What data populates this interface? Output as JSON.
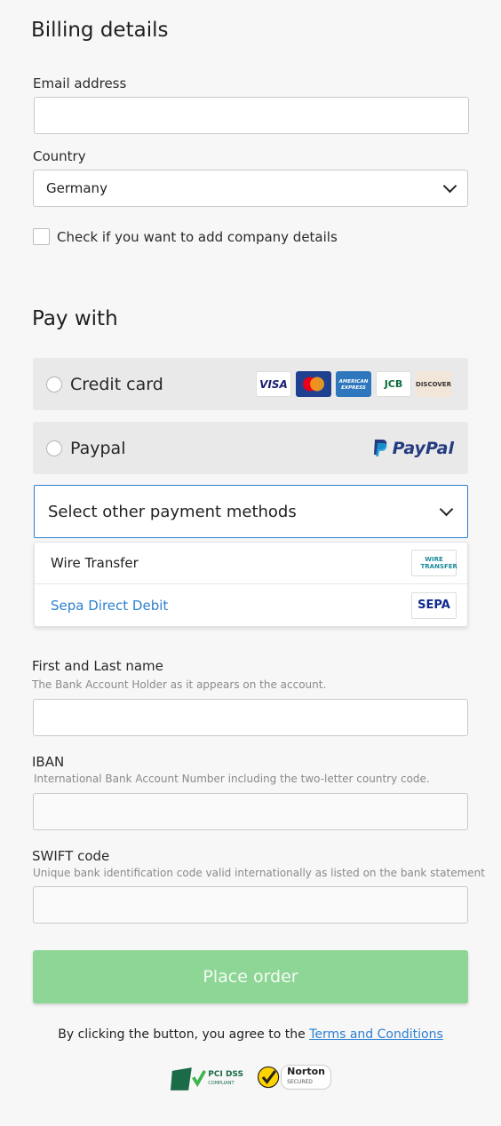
{
  "billing": {
    "title": "Billing details",
    "email_label": "Email address",
    "email_value": "",
    "country_label": "Country",
    "country_value": "Germany",
    "company_checkbox_label": "Check if you want to add company details"
  },
  "payment": {
    "title": "Pay with",
    "credit_card_label": "Credit card",
    "card_logos": [
      "VISA",
      "MasterCard",
      "AMERICAN EXPRESS",
      "JCB",
      "DISCOVER"
    ],
    "paypal_label": "Paypal",
    "paypal_logo": "PayPal",
    "other_methods_label": "Select other payment methods",
    "options": [
      {
        "label": "Wire Transfer",
        "logo": "WIRE TRANSFER",
        "color": "#222222"
      },
      {
        "label": "Sepa Direct Debit",
        "logo": "SEPA",
        "color": "#2d7fd0"
      }
    ]
  },
  "sepa_form": {
    "name_label": "First and Last name",
    "name_hint": "The Bank Account Holder as it appears on the account.",
    "iban_label": "IBAN",
    "iban_hint": "International Bank Account Number including the two-letter country code.",
    "swift_label": "SWIFT code",
    "swift_hint": "Unique bank identification code valid internationally as listed on the bank statement"
  },
  "order": {
    "button_label": "Place order",
    "agreement_text": "By clicking the button, you agree to the ",
    "terms_link": "Terms and Conditions"
  },
  "badges": {
    "pci": "PCI DSS",
    "pci_sub": "COMPLIANT",
    "norton": "Norton",
    "norton_sub": "SECURED"
  },
  "colors": {
    "accent": "#2d7fd0",
    "button_bg": "#8ed696",
    "row_bg": "#e9e9e9"
  }
}
